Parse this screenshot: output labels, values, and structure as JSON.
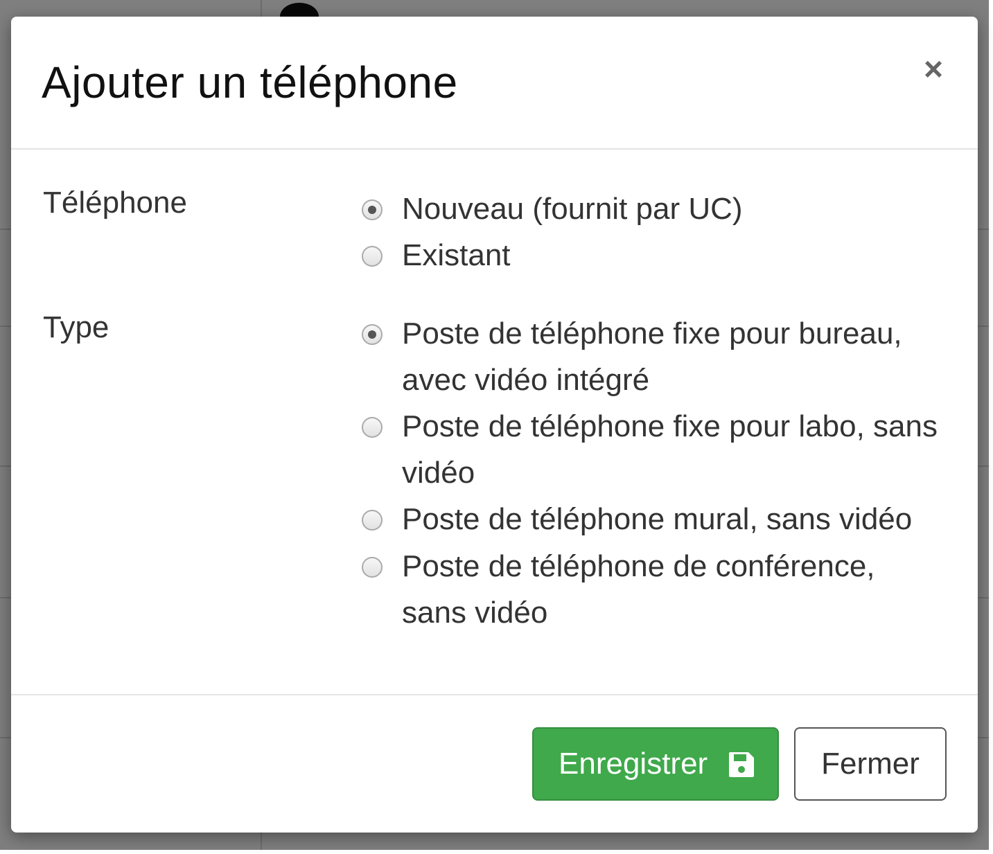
{
  "modal": {
    "title": "Ajouter un téléphone",
    "close_symbol": "×"
  },
  "form": {
    "telephone": {
      "label": "Téléphone",
      "options": [
        {
          "label": "Nouveau (fournit par UC)",
          "checked": true
        },
        {
          "label": "Existant",
          "checked": false
        }
      ]
    },
    "type": {
      "label": "Type",
      "options": [
        {
          "label": "Poste de téléphone fixe pour bureau, avec vidéo intégré",
          "checked": true
        },
        {
          "label": "Poste de téléphone fixe pour labo, sans vidéo",
          "checked": false
        },
        {
          "label": "Poste de téléphone mural, sans vidéo",
          "checked": false
        },
        {
          "label": "Poste de téléphone de conférence, sans vidéo",
          "checked": false
        }
      ]
    }
  },
  "footer": {
    "save_label": "Enregistrer",
    "save_icon": "floppy-disk-icon",
    "close_label": "Fermer"
  },
  "colors": {
    "save_button": "#3fa94b",
    "backdrop": "rgba(0,0,0,0.5)"
  }
}
